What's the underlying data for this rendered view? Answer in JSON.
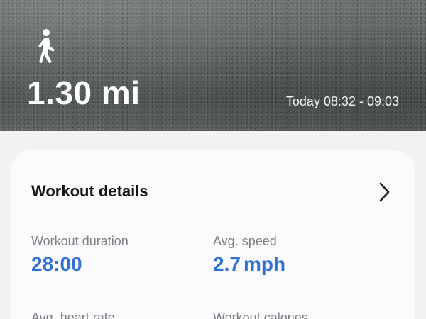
{
  "header": {
    "activity_icon": "walking-person-icon",
    "distance": "1.30 mi",
    "time_range": "Today 08:32 - 09:03"
  },
  "details_card": {
    "title": "Workout details",
    "chevron_icon": "chevron-right-icon",
    "stats": [
      {
        "label": "Workout duration",
        "value": "28:00",
        "unit": ""
      },
      {
        "label": "Avg. speed",
        "value": "2.7",
        "unit": "mph"
      },
      {
        "label": "Avg. heart rate",
        "value": "",
        "unit": ""
      },
      {
        "label": "Workout calories",
        "value": "",
        "unit": ""
      }
    ]
  },
  "colors": {
    "accent": "#2f6fd8",
    "background": "#f2f2f4",
    "card": "#fbfbfd"
  }
}
